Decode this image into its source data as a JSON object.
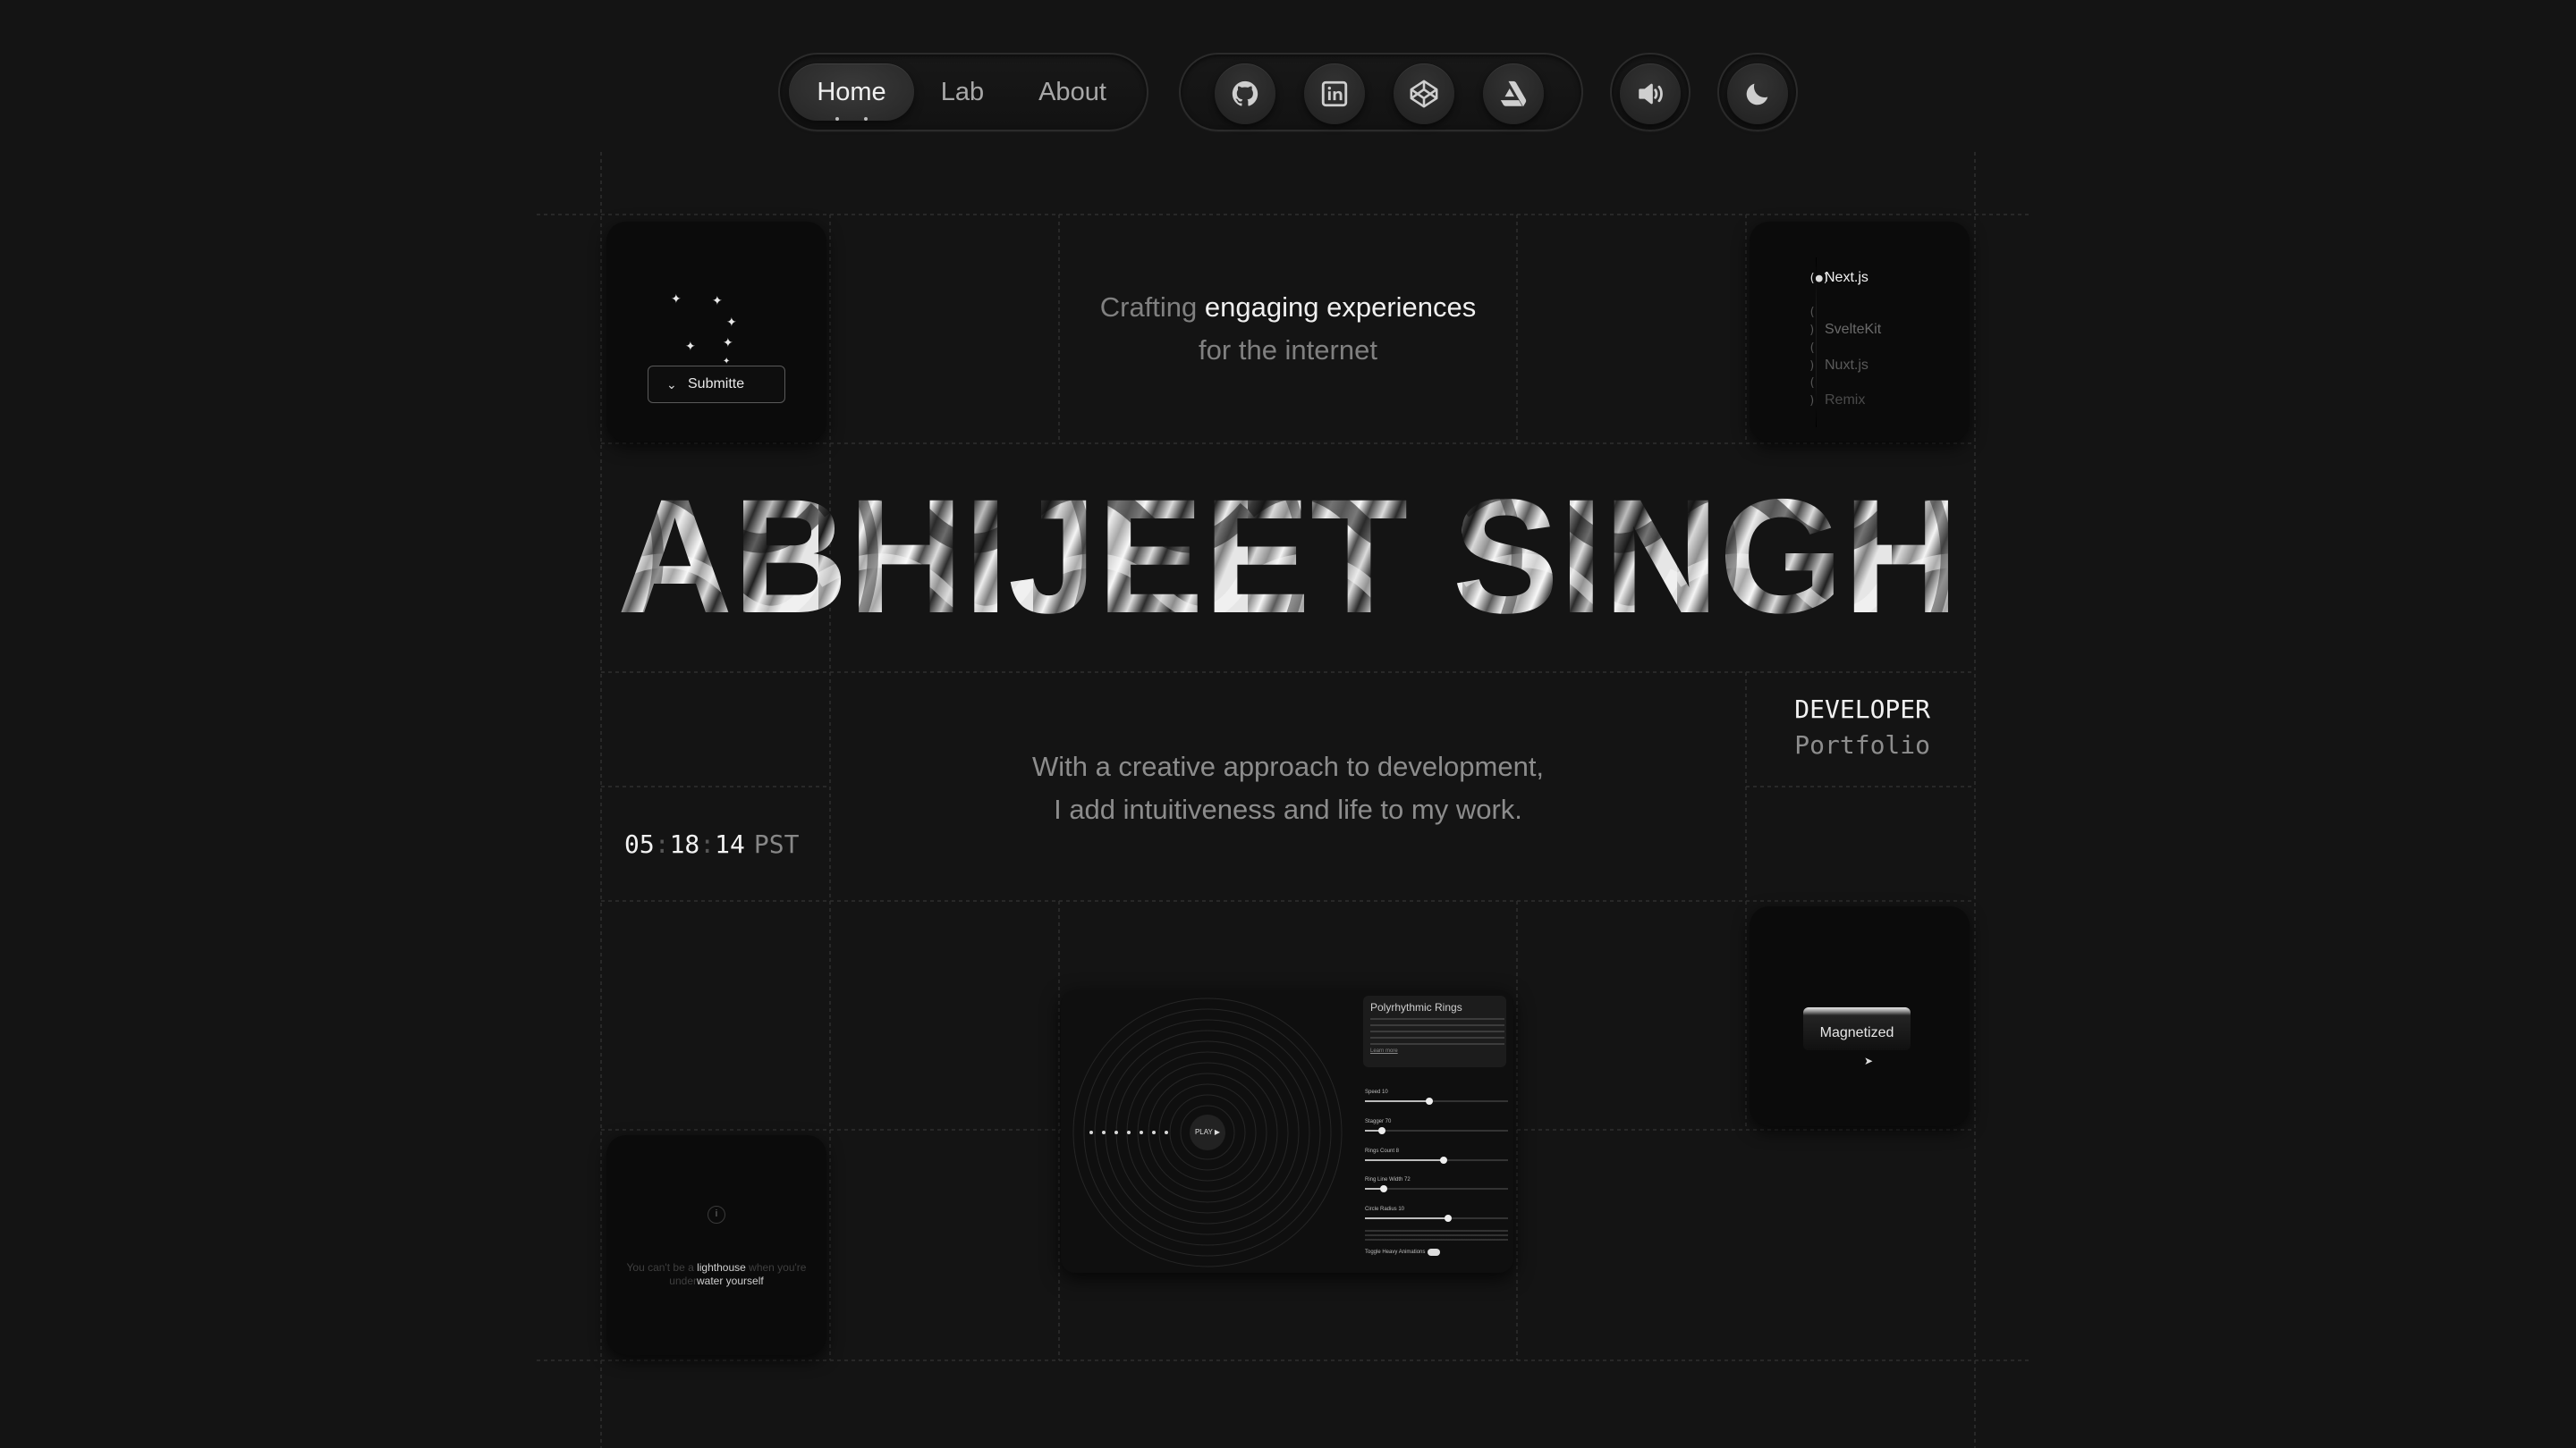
{
  "nav": {
    "links": [
      {
        "label": "Home",
        "active": true
      },
      {
        "label": "Lab",
        "active": false
      },
      {
        "label": "About",
        "active": false
      }
    ],
    "social": [
      "github-icon",
      "linkedin-icon",
      "codepen-icon",
      "artstation-icon"
    ],
    "sound_icon": "speaker-icon",
    "theme_icon": "moon-icon"
  },
  "hero": {
    "tagline_pre": "Crafting ",
    "tagline_highlight": "engaging experiences",
    "tagline_post": "for the internet",
    "name": "ABHIJEET SINGH",
    "role_line1": "DEVELOPER",
    "role_line2": "Portfolio",
    "subtitle_line1": "With a creative approach to development,",
    "subtitle_line2": "I add intuitiveness and life to my work."
  },
  "clock": {
    "hh": "05",
    "mm": "18",
    "ss": "14",
    "tz": "PST",
    "sep": ":"
  },
  "tiles": {
    "submit": {
      "button_label": "Submitte"
    },
    "frameworks": {
      "options": [
        "Next.js",
        "SvelteKit",
        "Nuxt.js",
        "Remix"
      ],
      "selected": "Next.js"
    },
    "magnet": {
      "button_label": "Magnetized"
    },
    "lighthouse": {
      "q1": "You can't be a ",
      "q2": "lighthouse",
      "q3": " when you're",
      "q4": "under",
      "q5": "water yourself"
    }
  },
  "lab_preview": {
    "title": "Polyrhythmic Rings",
    "link": "Learn more",
    "play_label": "PLAY ▶",
    "sliders": [
      {
        "label": "Speed 10",
        "value": 0.45
      },
      {
        "label": "Stagger 70",
        "value": 0.12
      },
      {
        "label": "Rings Count 8",
        "value": 0.55
      },
      {
        "label": "Ring Line Width 72",
        "value": 0.13
      },
      {
        "label": "Circle Radius 10",
        "value": 0.58
      }
    ],
    "toggle_label": "Toggle Heavy Animations"
  },
  "colors": {
    "background": "#141414",
    "text": "#f0f0f0",
    "muted": "#808080",
    "tile": "#0b0b0b"
  }
}
